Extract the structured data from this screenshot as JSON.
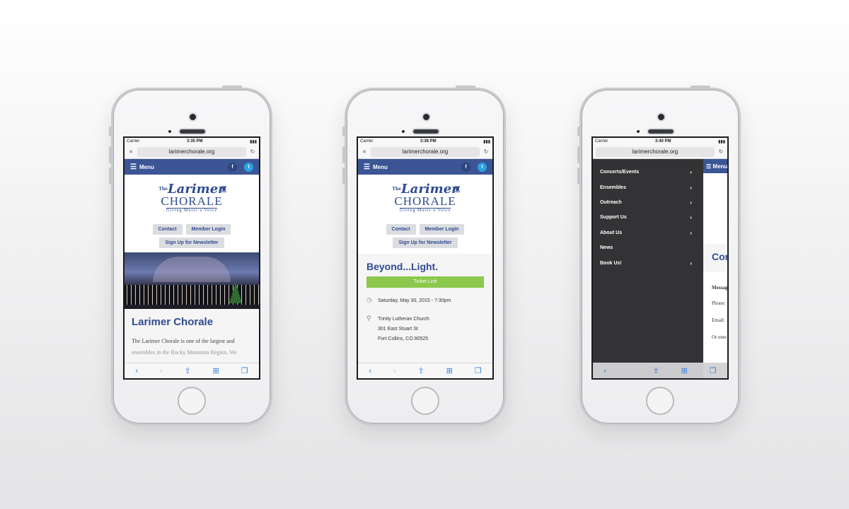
{
  "phones": [
    {
      "status": {
        "carrier": "Carrier",
        "time": "3:35 PM"
      },
      "url": "larimerchorale.org",
      "menu_label": "Menu",
      "logo": {
        "the": "The",
        "name_top": "Larimer",
        "name_bottom": "CHORALE",
        "tagline": "Giving Music a Voice"
      },
      "buttons": [
        "Contact",
        "Member Login",
        "Sign Up for Newsletter"
      ],
      "heading": "Larimer Chorale",
      "paragraph": "The Larimer Chorale is one of the largest and",
      "paragraph_2": "ensembles in the Rocky Mountain Region. We"
    },
    {
      "status": {
        "carrier": "Carrier",
        "time": "3:38 PM"
      },
      "url": "larimerchorale.org",
      "menu_label": "Menu",
      "logo": {
        "the": "The",
        "name_top": "Larimer",
        "name_bottom": "CHORALE",
        "tagline": "Giving Music a Voice"
      },
      "buttons": [
        "Contact",
        "Member Login",
        "Sign Up for Newsletter"
      ],
      "event_title": "Beyond...Light.",
      "ticket_label": "Ticket Link",
      "date": "Saturday, May 30, 2015 - 7:30pm",
      "venue": "Trinity Lutheran Church",
      "street": "301 East Stuart St",
      "city": "Fort Collins, CO 80525"
    },
    {
      "status": {
        "carrier": "Carrier",
        "time": "3:40 PM"
      },
      "url": "larimerchorale.org",
      "menu_label": "Menu",
      "drawer_items": [
        {
          "label": "Concerts/Events",
          "chevron": true
        },
        {
          "label": "Ensembles",
          "chevron": true
        },
        {
          "label": "Outreach",
          "chevron": true
        },
        {
          "label": "Support Us",
          "chevron": true
        },
        {
          "label": "About Us",
          "chevron": true
        },
        {
          "label": "News",
          "chevron": false
        },
        {
          "label": "Book Us!",
          "chevron": true
        }
      ],
      "peek": {
        "heading": "Con",
        "message": "Messag",
        "phone": "Phone:",
        "email": "Email:",
        "enter": "Or ente"
      }
    }
  ],
  "icons": {
    "facebook": "f",
    "twitter": "t"
  }
}
